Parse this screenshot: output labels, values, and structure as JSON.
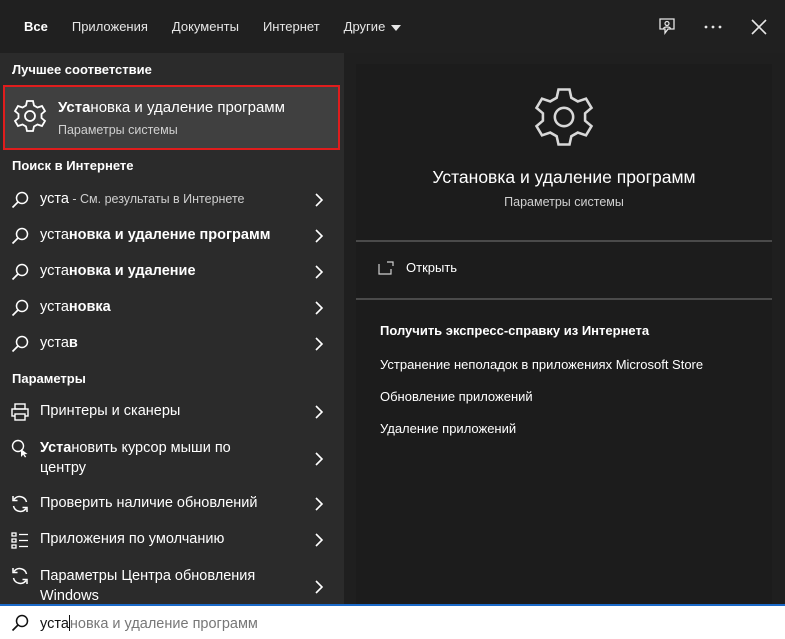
{
  "tabs": [
    {
      "label": "Все",
      "active": true
    },
    {
      "label": "Приложения"
    },
    {
      "label": "Документы"
    },
    {
      "label": "Интернет"
    },
    {
      "label": "Другие"
    }
  ],
  "top_icons": [
    "feedback-icon",
    "more-icon",
    "close-icon"
  ],
  "sections": {
    "best_match": "Лучшее соответствие",
    "web_search": "Поиск в Интернете",
    "settings": "Параметры"
  },
  "best_match": {
    "title_bold": "Уста",
    "title_rest": "новка и удаление программ",
    "subtitle": "Параметры системы"
  },
  "web_results": [
    {
      "typed": "уста",
      "bold": "",
      "hint": " - См. результаты в Интернете"
    },
    {
      "typed": "уста",
      "bold": "новка и удаление программ",
      "hint": ""
    },
    {
      "typed": "уста",
      "bold": "новка и удаление",
      "hint": ""
    },
    {
      "typed": "уста",
      "bold": "новка",
      "hint": ""
    },
    {
      "typed": "уста",
      "bold": "в",
      "hint": ""
    }
  ],
  "settings_results": [
    {
      "icon": "printer-icon",
      "text": "Принтеры и сканеры"
    },
    {
      "icon": "mouse-pointer-icon",
      "bold": "Уста",
      "text": "новить курсор мыши по центру"
    },
    {
      "icon": "sync-icon",
      "text": "Проверить наличие обновлений"
    },
    {
      "icon": "default-apps-icon",
      "text": "Приложения по умолчанию"
    },
    {
      "icon": "sync-icon",
      "text": "Параметры Центра обновления Windows"
    }
  ],
  "preview": {
    "title": "Установка и удаление программ",
    "subtitle": "Параметры системы",
    "open_label": "Открыть",
    "help_title": "Получить экспресс-справку из Интернета",
    "links": [
      "Устранение неполадок в приложениях Microsoft Store",
      "Обновление приложений",
      "Удаление приложений"
    ]
  },
  "search": {
    "typed": "уста",
    "suggestion": "новка и удаление программ"
  },
  "colors": {
    "highlight_border": "#e01d1d",
    "accent": "#1b6ac9"
  }
}
